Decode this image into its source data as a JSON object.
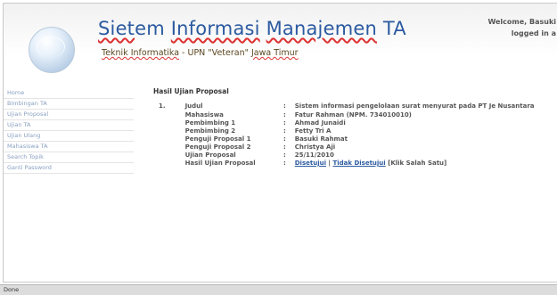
{
  "header": {
    "title_part1": "Siet",
    "title_part2": "em ",
    "title_part3": "Informasi",
    "title_part4": " ",
    "title_part5": "Manajemen",
    "title_part6": " TA",
    "subtitle_part1": "Teknik Informatika",
    "subtitle_part2": " - UPN \"Veteran\" ",
    "subtitle_part3": "Jawa Timur",
    "welcome_line1": "Welcome, Basuki",
    "welcome_line2": "logged in a"
  },
  "sidebar": {
    "items": [
      {
        "label": "Home"
      },
      {
        "label": "Bimbingan TA"
      },
      {
        "label": "Ujian Proposal"
      },
      {
        "label": "Ujian TA"
      },
      {
        "label": "Ujian Ulang"
      },
      {
        "label": "Mahasiswa TA"
      },
      {
        "label": "Search Topik"
      },
      {
        "label": "Ganti Password"
      }
    ]
  },
  "main": {
    "section_title": "Hasil Ujian Proposal",
    "number": "1.",
    "separator": ":",
    "rows": [
      {
        "label": "Judul",
        "value": "Sistem informasi pengelolaan surat menyurat pada PT Je Nusantara"
      },
      {
        "label": "Mahasiswa",
        "value": "Fatur Rahman (NPM. 734010010)"
      },
      {
        "label": "Pembimbing 1",
        "value": "Ahmad Junaidi"
      },
      {
        "label": "Pembimbing 2",
        "value": "Fetty Tri A"
      },
      {
        "label": "Penguji Proposal 1",
        "value": "Basuki Rahmat"
      },
      {
        "label": "Penguji Proposal 2",
        "value": "Christya Aji"
      },
      {
        "label": "Ujian Proposal",
        "value": "25/11/2010"
      }
    ],
    "result_label": "Hasil Ujian Proposal",
    "accept_link": "Disetujui",
    "link_divider": " | ",
    "reject_link": "Tidak Disetujui",
    "result_note": " [Klik Salah Satu]"
  },
  "status_bar": {
    "text": "Done"
  },
  "colors": {
    "title_blue": "#2c5aa0",
    "nav_text": "#8aa0c0",
    "link": "#2c5aa0"
  }
}
